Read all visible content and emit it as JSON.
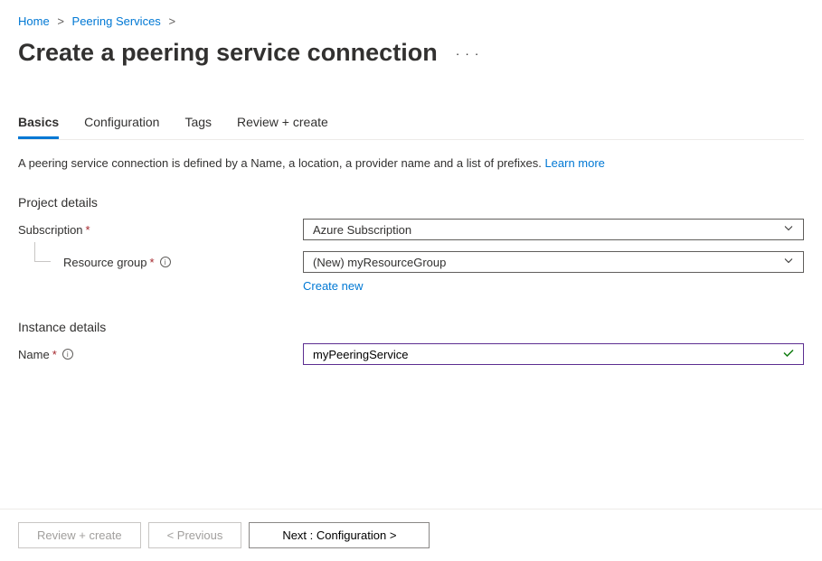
{
  "breadcrumb": {
    "home": "Home",
    "peering": "Peering Services"
  },
  "page_title": "Create a peering service connection",
  "tabs": {
    "basics": "Basics",
    "configuration": "Configuration",
    "tags": "Tags",
    "review": "Review + create"
  },
  "description": {
    "text": "A peering service connection is defined by a Name, a location, a provider name and a list of prefixes. ",
    "link": "Learn more"
  },
  "sections": {
    "project": "Project details",
    "instance": "Instance details"
  },
  "fields": {
    "subscription": {
      "label": "Subscription",
      "value": "Azure Subscription"
    },
    "resource_group": {
      "label": "Resource group",
      "value": "(New) myResourceGroup",
      "create_new": "Create new"
    },
    "name": {
      "label": "Name",
      "value": "myPeeringService"
    }
  },
  "footer": {
    "review": "Review + create",
    "previous": "< Previous",
    "next": "Next : Configuration >"
  }
}
